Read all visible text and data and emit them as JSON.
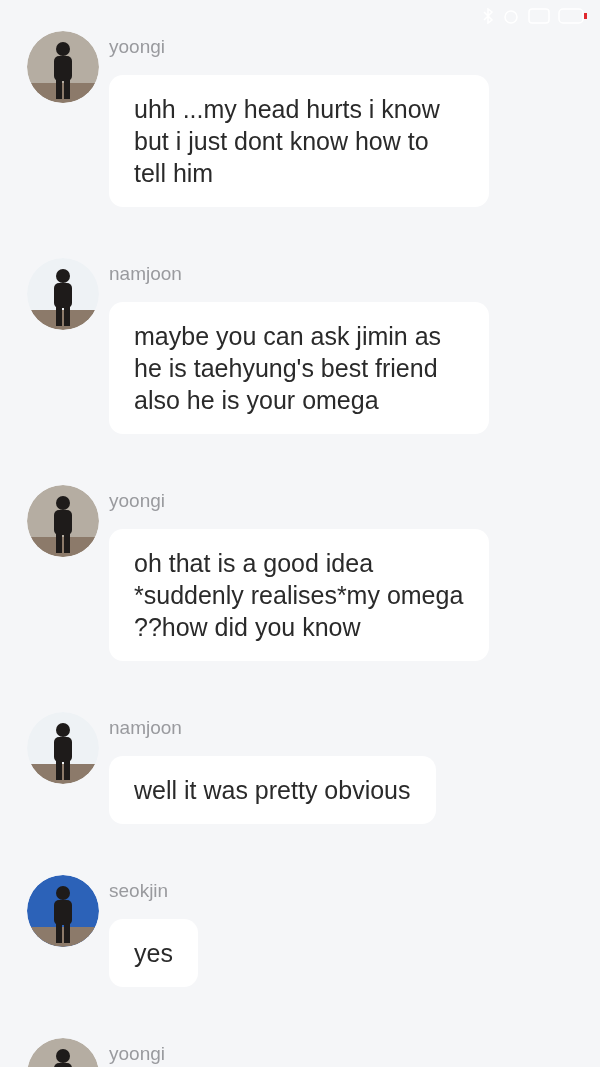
{
  "messages": [
    {
      "sender": "yoongi",
      "text": "uhh ...my head hurts i know but i just dont know how to tell him"
    },
    {
      "sender": "namjoon",
      "text": "maybe you can ask jimin as he is taehyung's best friend also he is your omega"
    },
    {
      "sender": "yoongi",
      "text": "oh that is a good idea *suddenly realises*my omega ??how did you know"
    },
    {
      "sender": "namjoon",
      "text": "well it was pretty obvious"
    },
    {
      "sender": "seokjin",
      "text": "yes"
    },
    {
      "sender": "yoongi"
    }
  ]
}
